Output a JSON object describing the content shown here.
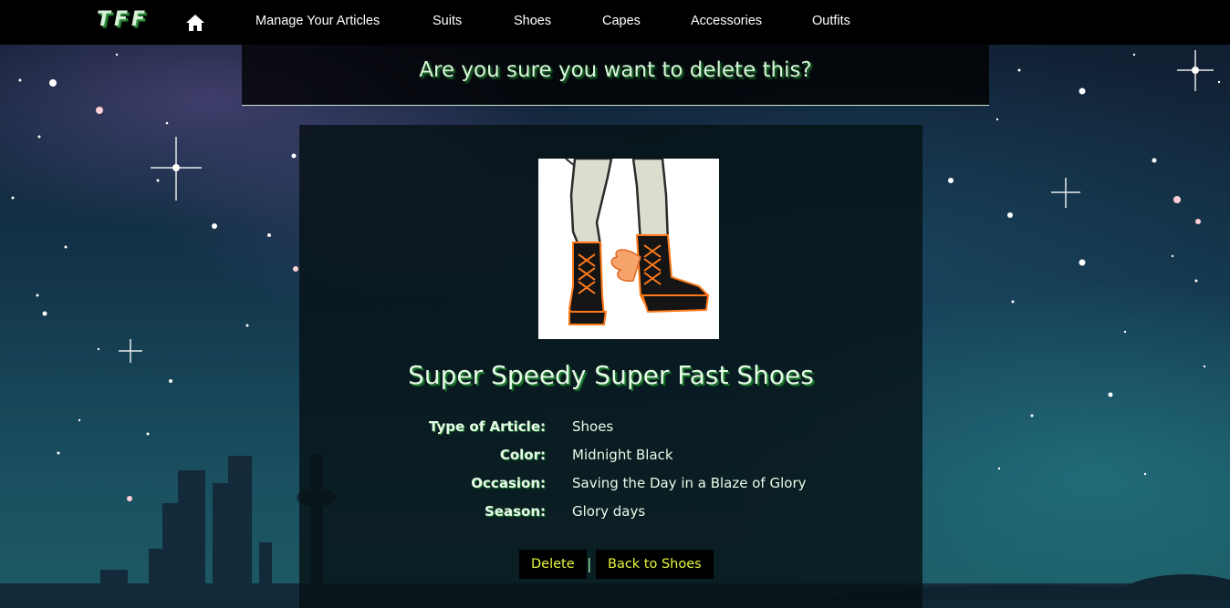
{
  "brand": "TFF",
  "nav": {
    "home_icon": "home-icon",
    "links": [
      "Manage Your Articles",
      "Suits",
      "Shoes",
      "Capes",
      "Accessories",
      "Outfits"
    ]
  },
  "banner": {
    "title": "Are you sure you want to delete this?"
  },
  "item": {
    "image_alt": "shoes-image",
    "title": "Super Speedy Super Fast Shoes",
    "details": [
      {
        "label": "Type of Article:",
        "value": "Shoes"
      },
      {
        "label": "Color:",
        "value": "Midnight Black"
      },
      {
        "label": "Occasion:",
        "value": "Saving the Day in a Blaze of Glory"
      },
      {
        "label": "Season:",
        "value": "Glory days"
      }
    ]
  },
  "actions": {
    "delete_label": "Delete",
    "separator": "|",
    "back_label": "Back to Shoes"
  },
  "colors": {
    "accent_green": "#1c7d2c",
    "button_text": "#e8f53a",
    "navbar": "#000000"
  }
}
